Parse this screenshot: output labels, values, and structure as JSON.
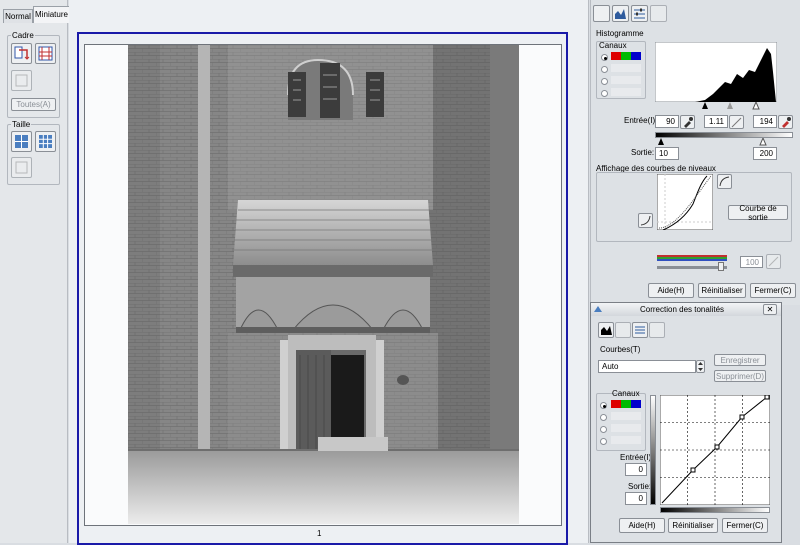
{
  "tabs": {
    "normal": "Normal",
    "miniature": "Miniature"
  },
  "left": {
    "cadre": "Cadre",
    "toutes": "Toutes(A)",
    "taille": "Taille"
  },
  "thumb": {
    "page_number": "1"
  },
  "histo_panel": {
    "title": "Histogramme",
    "canaux": "Canaux",
    "entree_label": "Entrée(I):",
    "entree_min": "90",
    "entree_gamma": "1.11",
    "entree_max": "194",
    "sortie_label": "Sortie:",
    "sortie_min": "10",
    "sortie_max": "200",
    "courbes_title": "Affichage des courbes de niveaux",
    "courbe_sortie": "Courbe de sortie",
    "slider_value": "100",
    "aide": "Aide(H)",
    "reinit": "Réinitialiser",
    "fermer": "Fermer(C)"
  },
  "tone": {
    "title": "Correction des tonalités",
    "close": "✕",
    "courbes_label": "Courbes(T)",
    "preset": "Auto",
    "enregistrer": "Enregistrer",
    "supprimer": "Supprimer(D)",
    "canaux": "Canaux",
    "entree_label": "Entrée(I):",
    "entree_value": "0",
    "sortie_label": "Sortie:",
    "sortie_value": "0",
    "aide": "Aide(H)",
    "reinit": "Réinitialiser",
    "fermer": "Fermer(C)"
  },
  "colors": {
    "accent_frame": "#1a1aa8",
    "panel_bg": "#dde1e5"
  }
}
